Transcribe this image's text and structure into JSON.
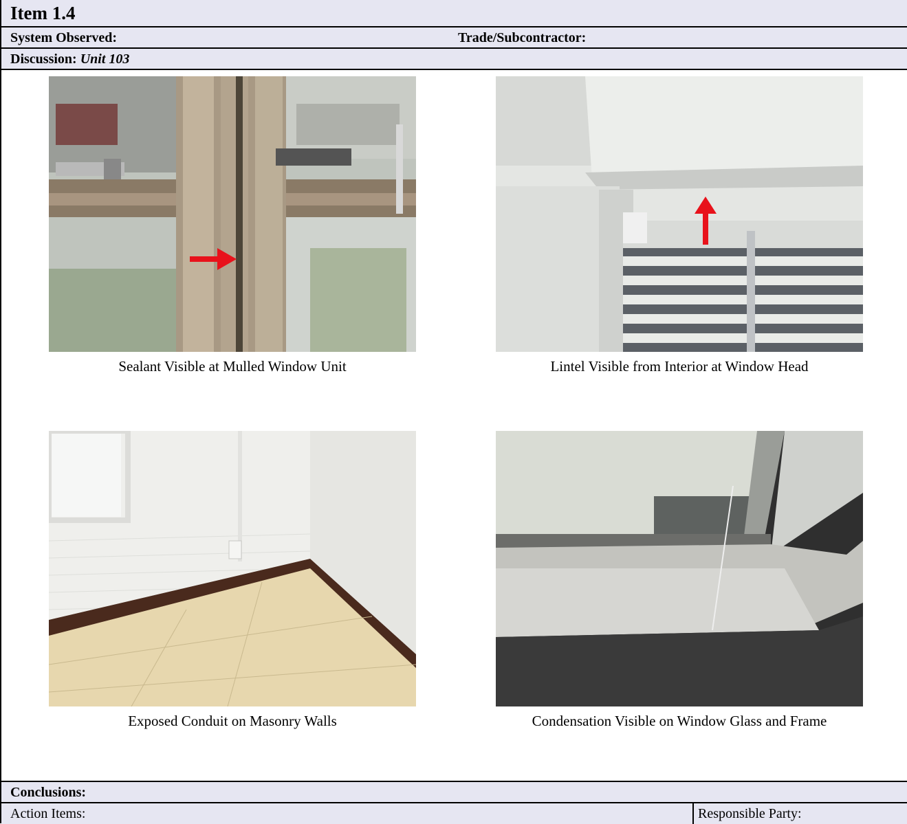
{
  "header": {
    "item_title": "Item 1.4",
    "system_observed_label": "System Observed:",
    "trade_label": "Trade/Subcontractor:",
    "discussion_label": "Discussion:",
    "discussion_value": "Unit 103"
  },
  "photos": [
    {
      "caption": "Sealant Visible at Mulled Window Unit"
    },
    {
      "caption": "Lintel Visible from Interior at Window Head"
    },
    {
      "caption": "Exposed Conduit on Masonry Walls"
    },
    {
      "caption": "Condensation Visible on Window Glass and Frame"
    }
  ],
  "footer": {
    "conclusions_label": "Conclusions:",
    "action_items_label": "Action Items:",
    "responsible_party_label": "Responsible Party:"
  },
  "colors": {
    "header_band": "#e6e6f2",
    "annotation_arrow": "#e8121b"
  }
}
